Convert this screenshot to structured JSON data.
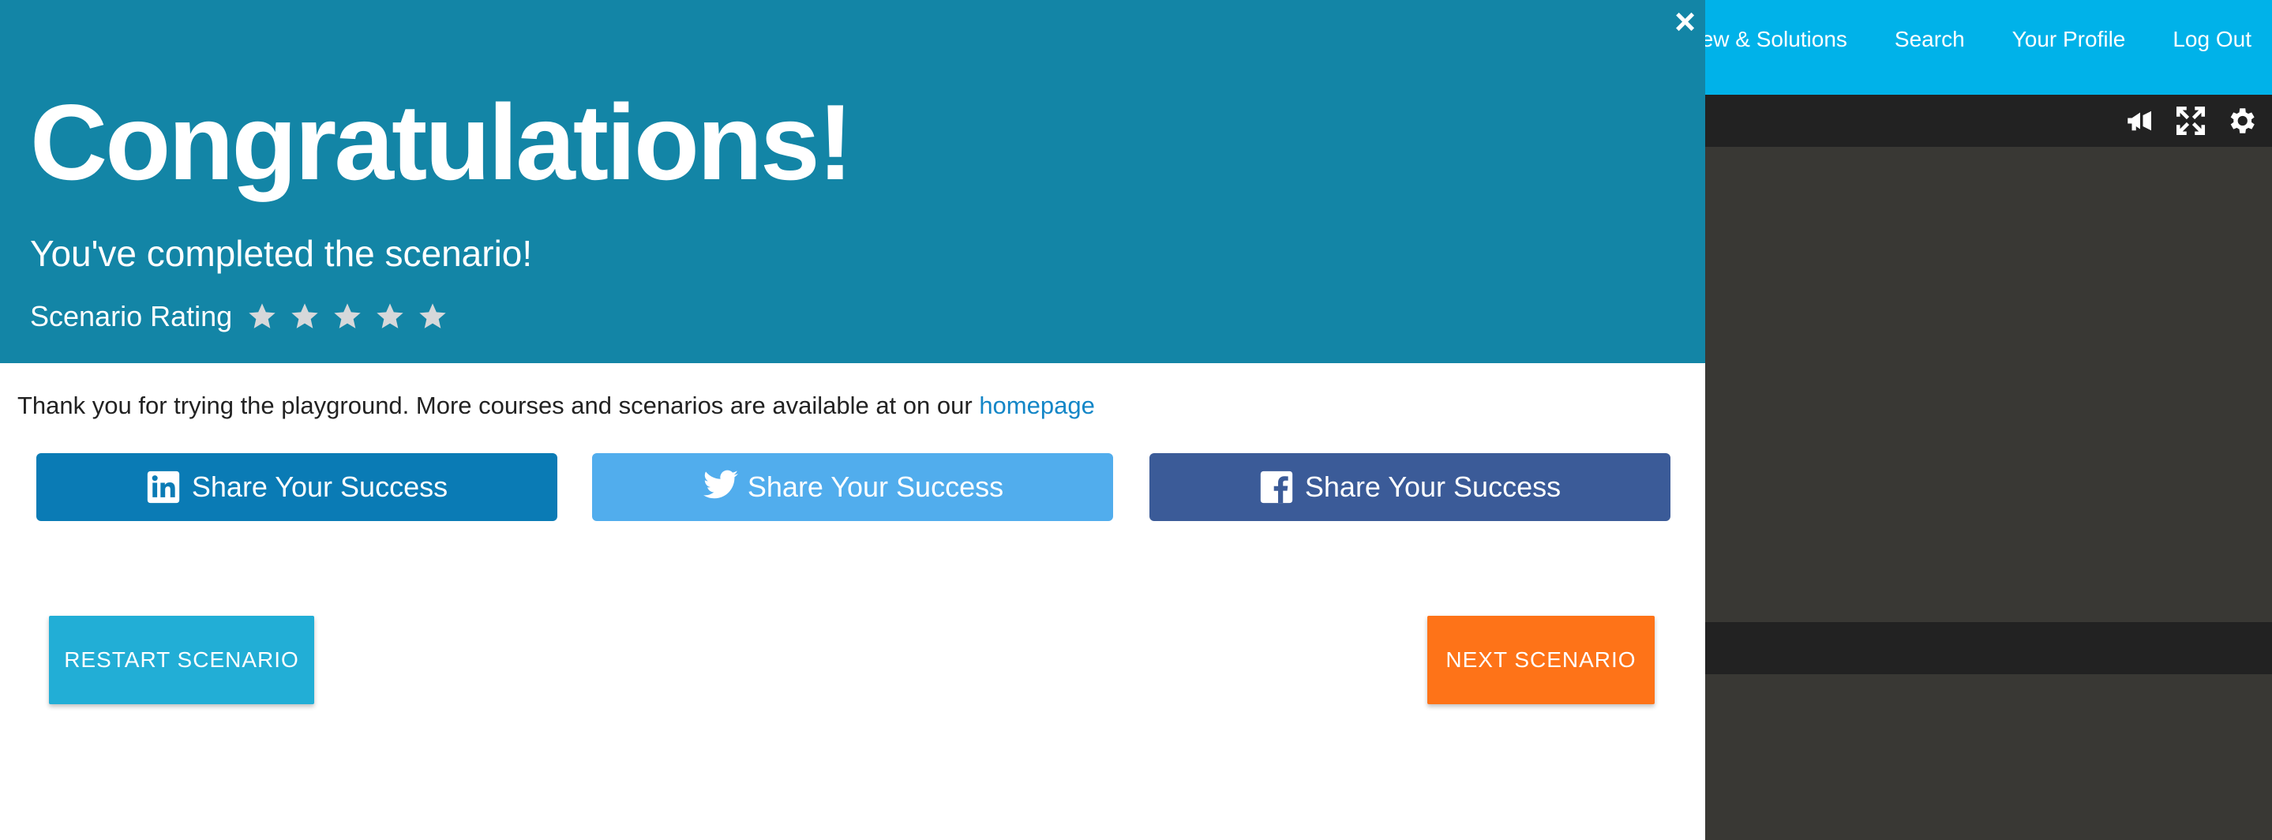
{
  "nav": {
    "links": [
      "ew & Solutions",
      "Search",
      "Your Profile",
      "Log Out"
    ]
  },
  "terminal": {
    "icons": [
      "megaphone-icon",
      "expand-icon",
      "gear-icon"
    ]
  },
  "modal": {
    "close_label": "×",
    "title": "Congratulations!",
    "subtitle": "You've completed the scenario!",
    "rating_label": "Scenario Rating",
    "rating": {
      "value": 0,
      "max": 5
    },
    "thanks_text": "Thank you for trying the playground. More courses and scenarios are available at on our",
    "homepage_link": "homepage",
    "share": {
      "linkedin_label": "Share Your Success",
      "twitter_label": "Share Your Success",
      "facebook_label": "Share Your Success"
    },
    "restart_label": "RESTART SCENARIO",
    "next_label": "NEXT SCENARIO"
  },
  "colors": {
    "header_bg": "#1385a6",
    "nav_bg": "#00b2e9",
    "linkedin": "#0a7bb5",
    "twitter": "#51aded",
    "facebook": "#3b5b98",
    "restart": "#22aed6",
    "next": "#fe7318",
    "link": "#1386c7"
  }
}
